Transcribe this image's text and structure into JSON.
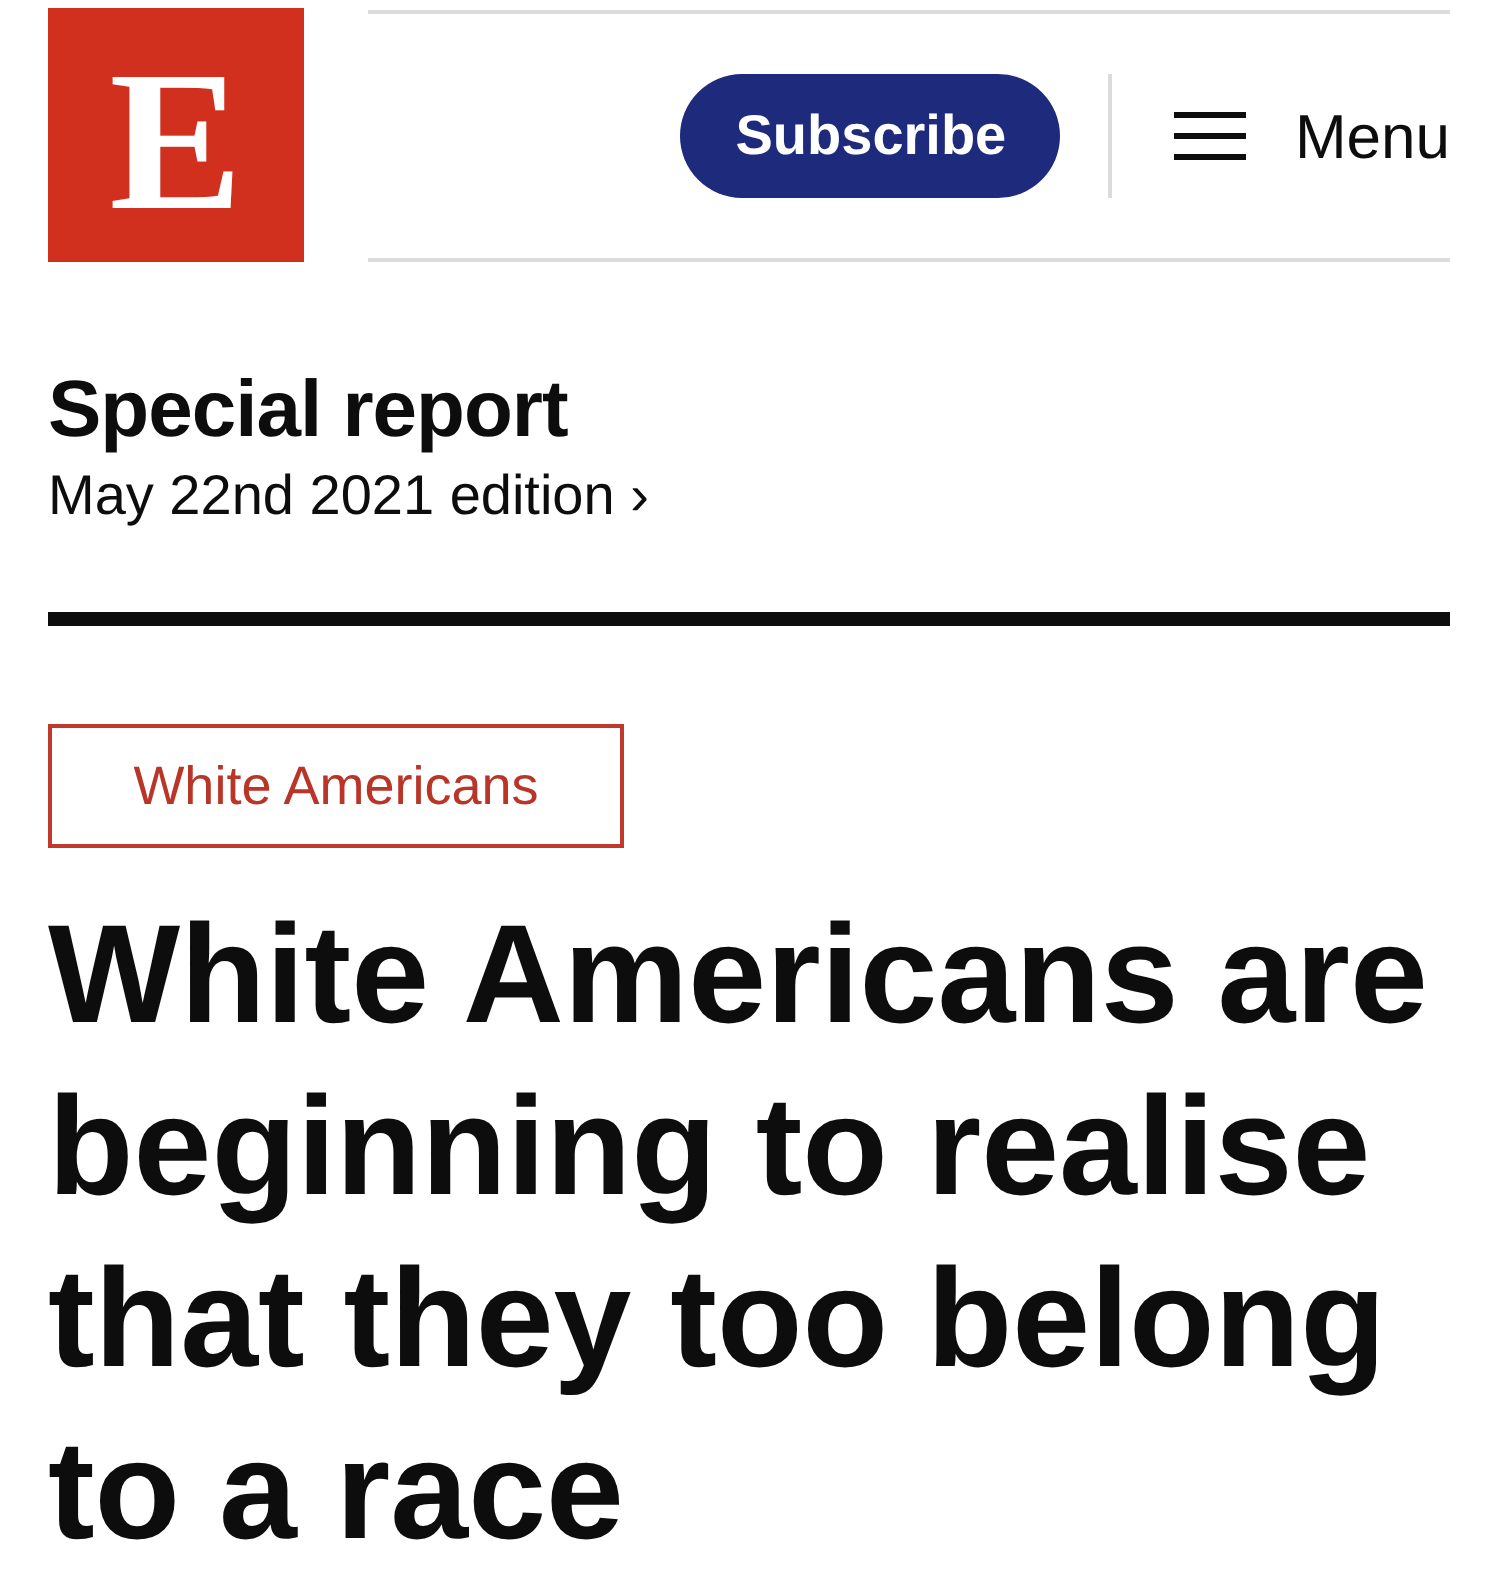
{
  "logo": {
    "letter": "E"
  },
  "header": {
    "subscribe_button": "Subscribe",
    "menu_button": "Menu"
  },
  "section": {
    "title": "Special report",
    "edition_link": "May 22nd 2021 edition ›"
  },
  "article": {
    "topic_tag": "White Americans",
    "headline": "White Americans are beginning to realise that they too belong to a race"
  }
}
